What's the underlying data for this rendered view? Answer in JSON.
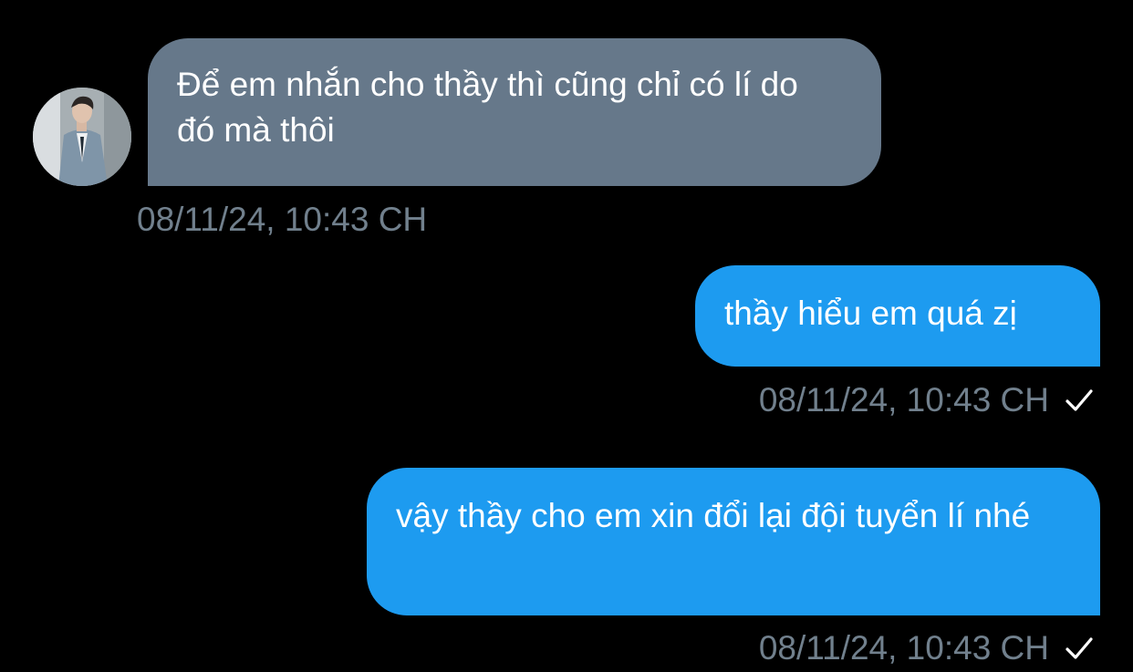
{
  "messages": [
    {
      "direction": "received",
      "text": "Để em nhắn cho thầy thì cũng chỉ có lí do đó mà thôi",
      "timestamp": "08/11/24, 10:43 CH"
    },
    {
      "direction": "sent",
      "text": "thầy hiểu em quá zị",
      "timestamp": "08/11/24, 10:43 CH",
      "status_icon": "checkmark-icon"
    },
    {
      "direction": "sent",
      "text": "vậy thầy cho em xin đổi lại đội tuyển lí nhé",
      "timestamp": "08/11/24, 10:43 CH",
      "status_icon": "checkmark-icon"
    }
  ],
  "colors": {
    "background": "#000000",
    "received_bubble": "#66788a",
    "sent_bubble": "#1d9bf0",
    "timestamp_text": "#71808d",
    "message_text": "#ffffff"
  }
}
